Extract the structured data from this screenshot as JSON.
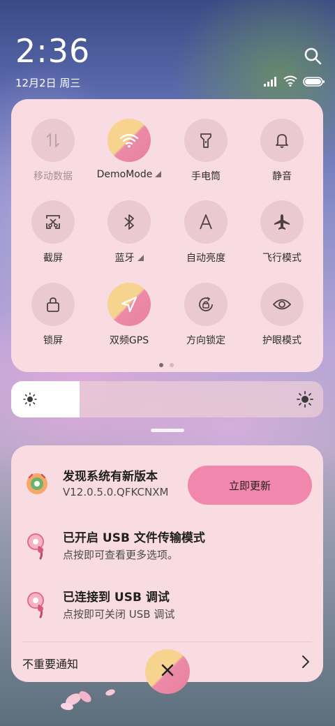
{
  "status_bar": {
    "time": "2:36",
    "date": "12月2日 周三",
    "icons": [
      "signal-icon",
      "wifi-icon",
      "battery-icon"
    ]
  },
  "quick_settings": {
    "tiles": [
      {
        "label": "移动数据",
        "icon": "mobile-data-icon",
        "active": false,
        "disabled": true
      },
      {
        "label": "DemoMode",
        "icon": "wifi-icon",
        "active": true,
        "has_menu": true
      },
      {
        "label": "手电筒",
        "icon": "flashlight-icon",
        "active": false
      },
      {
        "label": "静音",
        "icon": "bell-icon",
        "active": false
      },
      {
        "label": "截屏",
        "icon": "screenshot-icon",
        "active": false
      },
      {
        "label": "蓝牙",
        "icon": "bluetooth-icon",
        "active": false,
        "has_menu": true
      },
      {
        "label": "自动亮度",
        "icon": "auto-brightness-icon",
        "active": false
      },
      {
        "label": "飞行模式",
        "icon": "airplane-icon",
        "active": false
      },
      {
        "label": "锁屏",
        "icon": "lock-icon",
        "active": false
      },
      {
        "label": "双频GPS",
        "icon": "location-icon",
        "active": true
      },
      {
        "label": "方向锁定",
        "icon": "rotation-lock-icon",
        "active": false
      },
      {
        "label": "护眼模式",
        "icon": "eye-icon",
        "active": false
      }
    ],
    "page_count": 2,
    "current_page": 1
  },
  "brightness": {
    "level": 0.22
  },
  "notifications": [
    {
      "title": "发现系统有新版本",
      "subtitle": "V12.0.5.0.QFKCNXM",
      "action": "立即更新",
      "icon": "system-update-icon"
    },
    {
      "title": "已开启 USB 文件传输模式",
      "subtitle": "点按即可查看更多选项。",
      "icon": "usb-icon"
    },
    {
      "title": "已连接到 USB 调试",
      "subtitle": "点按即可关闭 USB 调试",
      "icon": "usb-debug-icon"
    }
  ],
  "unimportant": {
    "label": "不重要通知"
  },
  "colors": {
    "panel": "#f9dbe2",
    "accent_pink": "#f287ad",
    "accent_yellow": "#f6d48f",
    "tile_bg": "#ebc9d1"
  }
}
